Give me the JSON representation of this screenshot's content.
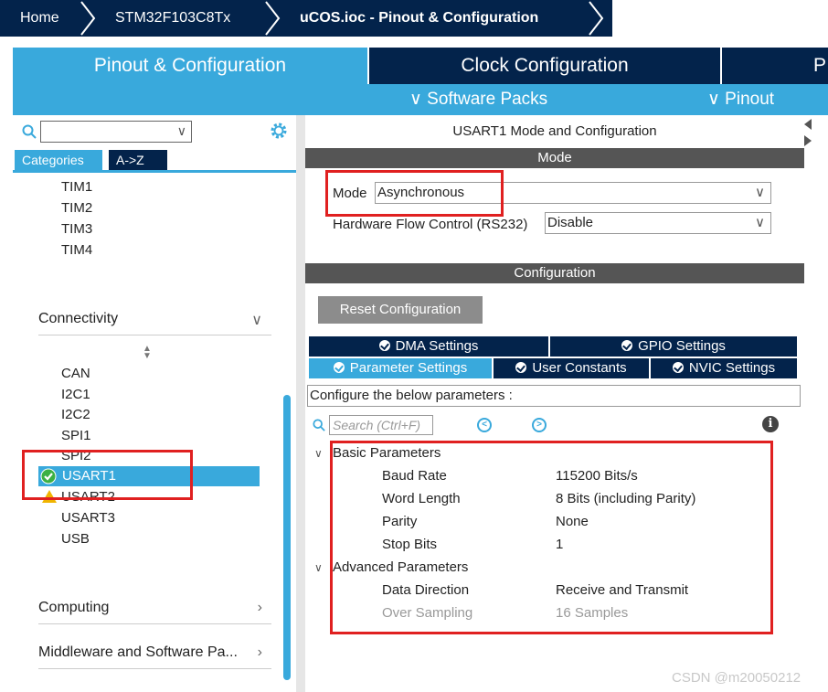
{
  "breadcrumb": {
    "home": "Home",
    "device": "STM32F103C8Tx",
    "file": "uCOS.ioc - Pinout & Configuration"
  },
  "main_tabs": [
    "Pinout & Configuration",
    "Clock Configuration",
    "P"
  ],
  "sub_bar": {
    "software_packs": "∨ Software Packs",
    "pinout": "∨ Pinout"
  },
  "left": {
    "cat_tab_categories": "Categories",
    "cat_tab_az": "A->Z",
    "timers": [
      "TIM1",
      "TIM2",
      "TIM3",
      "TIM4"
    ],
    "connectivity": "Connectivity",
    "connectivity_items": [
      "CAN",
      "I2C1",
      "I2C2",
      "SPI1",
      "SPI2"
    ],
    "usart1": "USART1",
    "usart2": "USART2",
    "usart3": "USART3",
    "usb": "USB",
    "computing": "Computing",
    "middleware": "Middleware and Software Pa..."
  },
  "right": {
    "title": "USART1 Mode and Configuration",
    "mode_header": "Mode",
    "mode_label": "Mode",
    "mode_value": "Asynchronous",
    "hwfc_label": "Hardware Flow Control (RS232)",
    "hwfc_value": "Disable",
    "config_header": "Configuration",
    "reset_button": "Reset Configuration",
    "tabs": {
      "dma": "DMA Settings",
      "gpio": "GPIO Settings",
      "params": "Parameter Settings",
      "user_consts": "User Constants",
      "nvic": "NVIC Settings"
    },
    "configure_text": "Configure the below parameters :",
    "search_placeholder": "Search (Ctrl+F)",
    "basic_group": "Basic Parameters",
    "advanced_group": "Advanced Parameters",
    "params": [
      {
        "name": "Baud Rate",
        "value": "115200 Bits/s"
      },
      {
        "name": "Word Length",
        "value": "8 Bits (including Parity)"
      },
      {
        "name": "Parity",
        "value": "None"
      },
      {
        "name": "Stop Bits",
        "value": "1"
      }
    ],
    "adv_params": [
      {
        "name": "Data Direction",
        "value": "Receive and Transmit"
      },
      {
        "name": "Over Sampling",
        "value": "16 Samples"
      }
    ]
  },
  "watermark": "CSDN @m20050212",
  "colors": {
    "navy": "#03234b",
    "accent": "#39a9dc",
    "highlight_red": "#e02020"
  }
}
